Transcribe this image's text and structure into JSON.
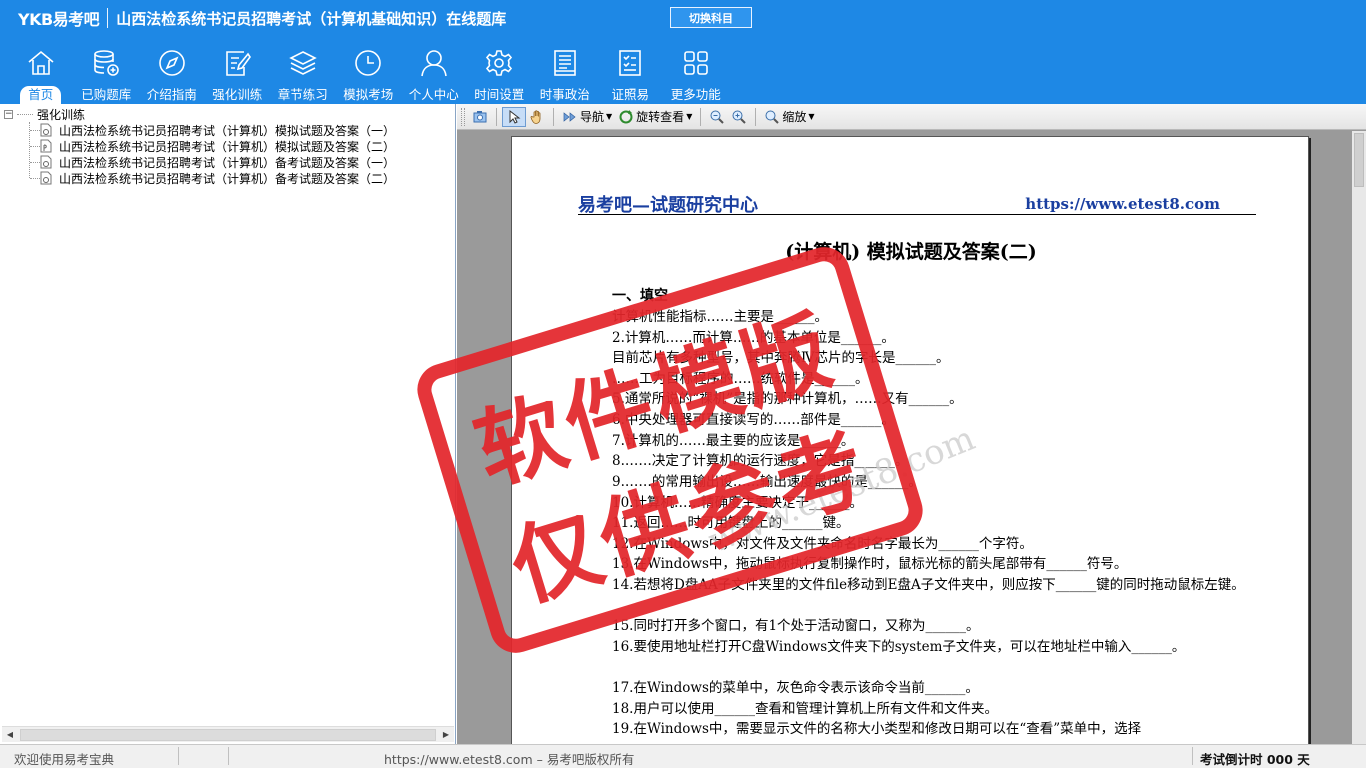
{
  "header": {
    "logo": "YKB易考吧",
    "title": "山西法检系统书记员招聘考试（计算机基础知识）在线题库",
    "switch_label": "切换科目"
  },
  "nav": [
    {
      "label": "首页",
      "icon": "home-icon"
    },
    {
      "label": "已购题库",
      "icon": "database-icon"
    },
    {
      "label": "介绍指南",
      "icon": "compass-icon"
    },
    {
      "label": "强化训练",
      "icon": "edit-icon"
    },
    {
      "label": "章节练习",
      "icon": "layers-icon"
    },
    {
      "label": "模拟考场",
      "icon": "clock-icon"
    },
    {
      "label": "个人中心",
      "icon": "user-icon"
    },
    {
      "label": "时间设置",
      "icon": "gear-icon"
    },
    {
      "label": "时事政治",
      "icon": "newspaper-icon"
    },
    {
      "label": "证照易",
      "icon": "checklist-icon"
    },
    {
      "label": "更多功能",
      "icon": "grid-icon"
    }
  ],
  "tree": {
    "root": "强化训练",
    "items": [
      "山西法检系统书记员招聘考试（计算机）模拟试题及答案（一）",
      "山西法检系统书记员招聘考试（计算机）模拟试题及答案（二）",
      "山西法检系统书记员招聘考试（计算机）备考试题及答案（一）",
      "山西法检系统书记员招聘考试（计算机）备考试题及答案（二）"
    ]
  },
  "toolbar": {
    "nav_label": "导航",
    "rotate_label": "旋转查看",
    "zoom_label": "缩放"
  },
  "document": {
    "head_left": "易考吧—试题研究中心",
    "head_right": "https://www.etest8.com",
    "title": "(计算机) 模拟试题及答案(二)",
    "section": "一、填空",
    "questions": [
      "计算机性能指标……主要是______。",
      "2.计算机……而计算……的基本单位是______。",
      "目前芯片有多种型号，其中奔腾Ⅳ芯片的字长是______。",
      "……工为目标程序的……统软件是______。",
      "5.通常所说的“裸机”是指的那种计算机，……又有______。",
      "6.中央处理器可直接读写的……部件是______。",
      "7.计算机的……最主要的应该是______。",
      "8.……决定了计算机的运行速度，它是指______。",
      "9.……的常用输出设……输出速度最快的是______。",
      "10.计算机……精确度主要决定于______。",
      "11.返回……时可用键盘上的______键。",
      "12.在Windows中，对文件及文件夹命名时名字最长为______个字符。",
      "13.在Windows中，拖动鼠标执行复制操作时，鼠标光标的箭头尾部带有______符号。",
      "14.若想将D盘AA子文件夹里的文件file移动到E盘A子文件夹中，则应按下______键的同时拖动鼠标左键。",
      "15.同时打开多个窗口，有1个处于活动窗口，又称为______。",
      "16.要使用地址栏打开C盘Windows文件夹下的system子文件夹，可以在地址栏中输入______。",
      "17.在Windows的菜单中，灰色命令表示该命令当前______。",
      "18.用户可以使用______查看和管理计算机上所有文件和文件夹。",
      "19.在Windows中，需要显示文件的名称大小类型和修改日期可以在“查看”菜单中，选择"
    ]
  },
  "watermark": {
    "line1": "软件模版",
    "line2": "仅供参考",
    "url": "www.etest8.com",
    "color": "#e3262b"
  },
  "status": {
    "left": "欢迎使用易考宝典",
    "middle": "https://www.etest8.com – 易考吧版权所有",
    "right": "考试倒计时 000 天"
  },
  "colors": {
    "header": "#1e88e5",
    "link": "#1a3fa0"
  }
}
